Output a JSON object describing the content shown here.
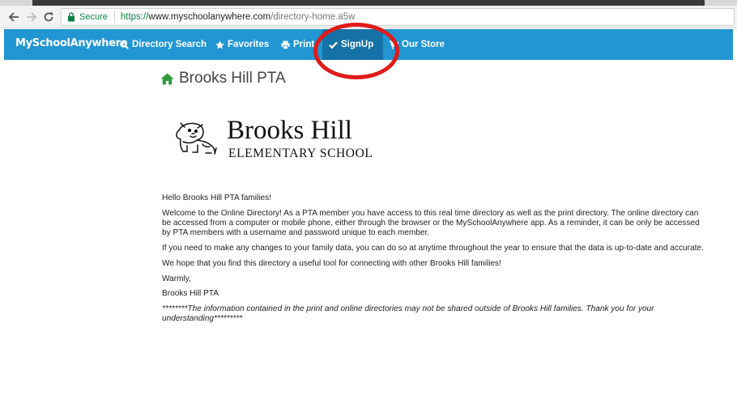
{
  "browser": {
    "secure_label": "Secure",
    "url_scheme": "https://",
    "url_host": "www.myschoolanywhere.com",
    "url_path": "/directory-home.a5w"
  },
  "navbar": {
    "brand": "MySchoolAnywhere",
    "items": [
      {
        "label": "Directory Search",
        "icon": "search-icon"
      },
      {
        "label": "Favorites",
        "icon": "star-icon"
      },
      {
        "label": "Print",
        "icon": "printer-icon"
      },
      {
        "label": "SignUp",
        "icon": "check-icon",
        "active": true
      },
      {
        "label": "Our Store",
        "icon": "cart-icon"
      }
    ],
    "bg_color": "#2196d3",
    "active_color": "#1572a6"
  },
  "annotation": {
    "color": "#e01b1b",
    "target": "SignUp"
  },
  "page": {
    "title": "Brooks Hill PTA",
    "title_icon": "home-icon",
    "title_icon_color": "#2e9a3a"
  },
  "logo": {
    "line1": "Brooks Hill",
    "line2": "ELEMENTARY SCHOOL",
    "mascot": "bulldog-icon"
  },
  "content": {
    "greeting": "Hello Brooks Hill PTA families!",
    "p1": "Welcome to the Online Directory!  As a PTA member you have access to this real time directory as well as the print directory. The online directory can be accessed from a computer or mobile phone, either through the browser or the MySchoolAnywhere app.  As a reminder, it can be only be accessed by PTA members with a username and password unique to each member.",
    "p2": "If you need to make any changes to your family data, you can do so at anytime throughout the year to ensure that the data is up-to-date and accurate.",
    "p3": "We hope that you find this directory a useful tool for connecting with other Brooks Hill families!",
    "closing": "Warmly,",
    "signature": "Brooks Hill PTA",
    "note": "********The information contained in the print and online directories may not be shared outside of Brooks Hill families.  Thank you for your understanding*********"
  }
}
